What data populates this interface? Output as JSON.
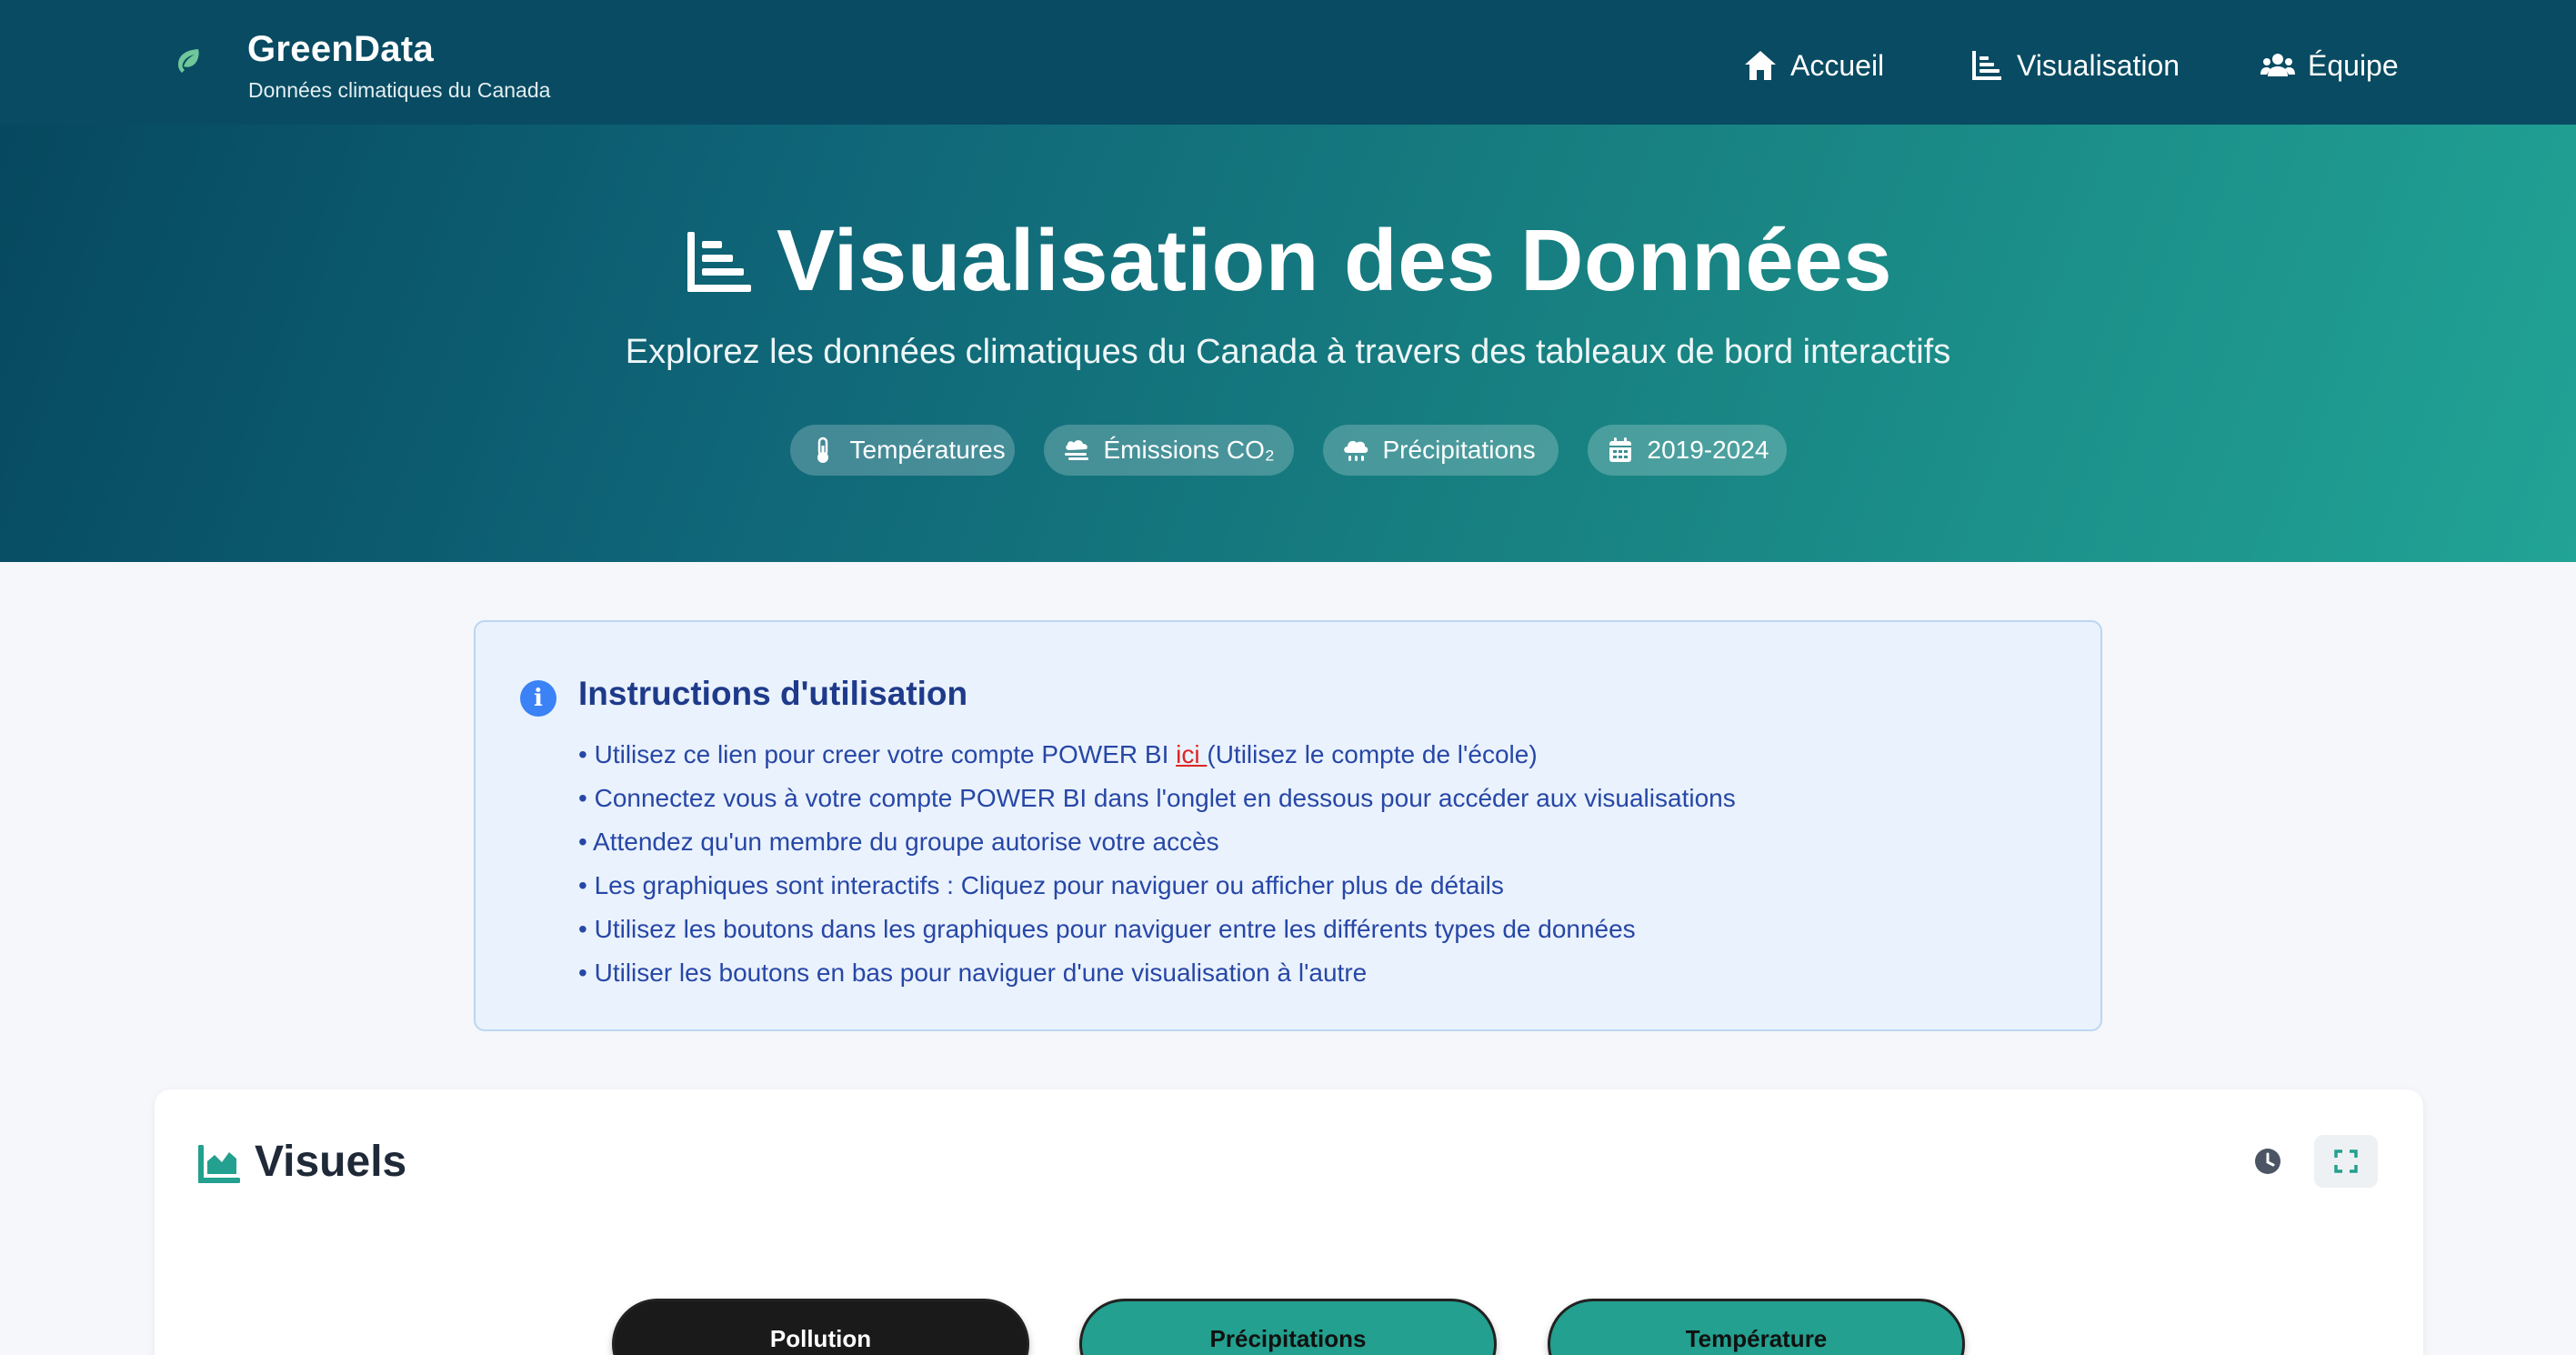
{
  "colors": {
    "navbar": "#084b62",
    "hero_start": "#06485f",
    "hero_end": "#21a395",
    "accent_teal": "#23a08f",
    "info_blue": "#3b82f6",
    "link_red": "#dc2626"
  },
  "brand": {
    "icon": "leaf-icon",
    "name": "GreenData",
    "subtitle": "Données climatiques du Canada"
  },
  "nav": [
    {
      "label": "Accueil",
      "icon": "home-icon"
    },
    {
      "label": "Visualisation",
      "icon": "chart-bar-icon"
    },
    {
      "label": "Équipe",
      "icon": "users-icon"
    }
  ],
  "hero": {
    "icon": "chart-bar-icon",
    "title": "Visualisation des Données",
    "subtitle": "Explorez les données climatiques du Canada à travers des tableaux de bord interactifs",
    "tags": [
      {
        "label": "Températures",
        "icon": "thermometer-icon"
      },
      {
        "label": "Émissions CO₂",
        "icon": "smog-icon"
      },
      {
        "label": "Précipitations",
        "icon": "cloud-rain-icon"
      },
      {
        "label": "2019-2024",
        "icon": "calendar-icon"
      }
    ]
  },
  "instructions": {
    "icon": "info-icon",
    "title": "Instructions d'utilisation",
    "item1_before": "Utilisez ce lien pour creer votre compte POWER BI ",
    "item1_link": "ici ",
    "item1_after": "(Utilisez le compte de l'école)",
    "items": [
      "Connectez vous à votre compte POWER BI dans l'onglet en dessous pour accéder aux visualisations",
      "Attendez qu'un membre du groupe autorise votre accès",
      "Les graphiques sont interactifs : Cliquez pour naviguer ou afficher plus de détails",
      "Utilisez les boutons dans les graphiques pour naviguer entre les différents types de données",
      "Utiliser les boutons en bas pour naviguer d'une visualisation à l'autre"
    ]
  },
  "visuels": {
    "icon": "chart-area-icon",
    "title": "Visuels",
    "actions": [
      "clock-icon",
      "expand-icon"
    ],
    "tabs": [
      "Pollution",
      "Précipitations",
      "Température"
    ],
    "active_tab": "Pollution"
  }
}
